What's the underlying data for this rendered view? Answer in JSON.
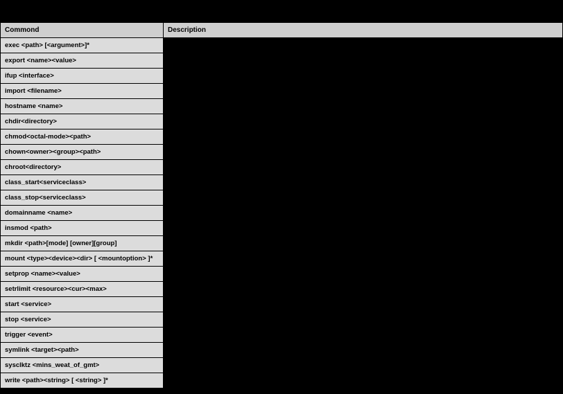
{
  "table": {
    "headers": {
      "command": "Commond",
      "description": "Description"
    },
    "rows": [
      {
        "command": "exec <path> [<argument>]*",
        "description": ""
      },
      {
        "command": "export <name><value>",
        "description": ""
      },
      {
        "command": "ifup <interface>",
        "description": ""
      },
      {
        "command": "import <filename>",
        "description": ""
      },
      {
        "command": "hostname <name>",
        "description": ""
      },
      {
        "command": "chdir<directory>",
        "description": ""
      },
      {
        "command": "chmod<octal-mode><path>",
        "description": ""
      },
      {
        "command": "chown<owner><group><path>",
        "description": ""
      },
      {
        "command": "chroot<directory>",
        "description": ""
      },
      {
        "command": "class_start<serviceclass>",
        "description": ""
      },
      {
        "command": "class_stop<serviceclass>",
        "description": ""
      },
      {
        "command": "domainname <name>",
        "description": ""
      },
      {
        "command": "insmod <path>",
        "description": ""
      },
      {
        "command": "mkdir <path>[mode] [owner][group]",
        "description": ""
      },
      {
        "command": "mount <type><device><dir> [ <mountoption> ]*",
        "description": ""
      },
      {
        "command": "setprop <name><value>",
        "description": ""
      },
      {
        "command": "setrlimit <resource><cur><max>",
        "description": ""
      },
      {
        "command": "start <service>",
        "description": ""
      },
      {
        "command": "stop <service>",
        "description": ""
      },
      {
        "command": "trigger <event>",
        "description": ""
      },
      {
        "command": "symlink <target><path>",
        "description": ""
      },
      {
        "command": "sysclktz <mins_weat_of_gmt>",
        "description": ""
      },
      {
        "command": "write <path><string> [ <string> ]*",
        "description": ""
      }
    ]
  }
}
